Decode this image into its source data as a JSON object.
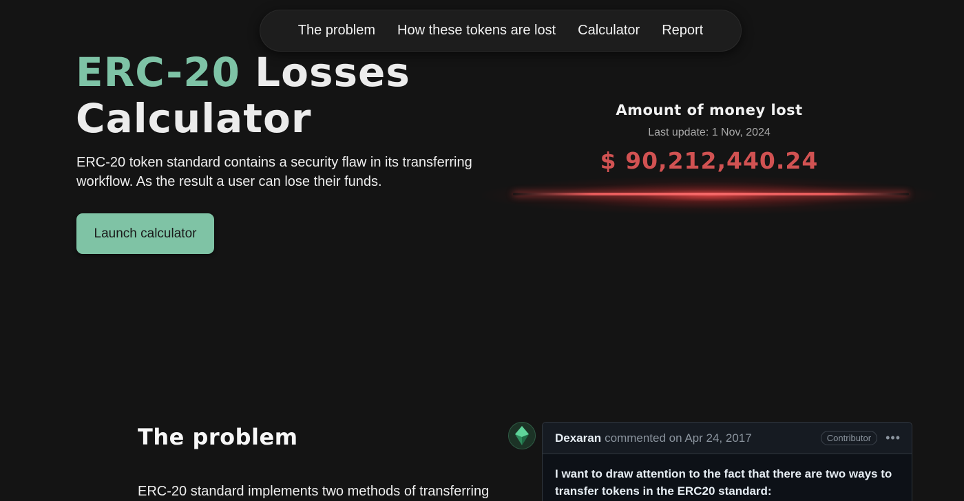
{
  "nav": {
    "items": [
      {
        "label": "The problem"
      },
      {
        "label": "How these tokens are lost"
      },
      {
        "label": "Calculator"
      },
      {
        "label": "Report"
      }
    ]
  },
  "hero": {
    "title_accent": "ERC-20",
    "title_rest_line1": " Losses",
    "title_line2": "Calculator",
    "description": "ERC-20 token standard contains a security flaw in its transferring workflow. As the result a user can lose their funds.",
    "launch_button": "Launch calculator"
  },
  "loss": {
    "title": "Amount of money lost",
    "last_update": "Last update: 1 Nov, 2024",
    "amount": "$ 90,212,440.24"
  },
  "problem": {
    "title": "The problem",
    "text": "ERC-20 standard implements two methods of transferring"
  },
  "comment": {
    "author": "Dexaran",
    "meta": "commented on Apr 24, 2017",
    "badge": "Contributor",
    "more_icon": "•••",
    "body": "I want to draw attention to the fact that there are two ways to transfer tokens in the ERC20 standard:"
  },
  "colors": {
    "background": "#141414",
    "accent": "#7ec3a6",
    "loss_red": "#d15252"
  }
}
